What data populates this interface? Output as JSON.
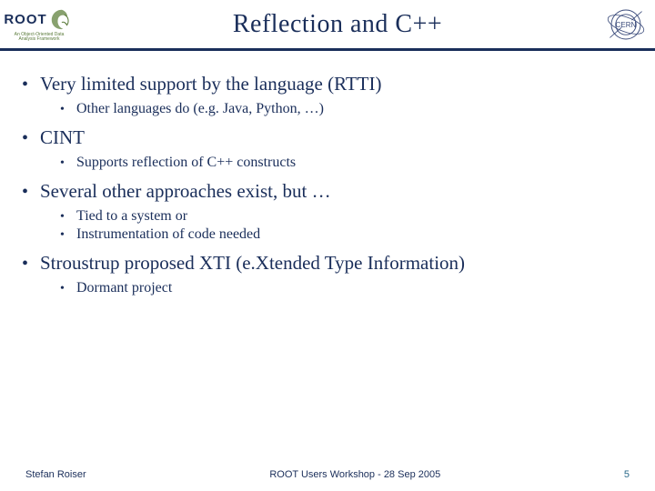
{
  "header": {
    "root_logo_text": "ROOT",
    "root_logo_sub": "An Object-Oriented Data Analysis Framework",
    "title": "Reflection and C++",
    "cern_label": "CERN"
  },
  "bullets": [
    {
      "text": "Very limited support by the language (RTTI)",
      "children": [
        "Other languages do (e.g. Java, Python, …)"
      ]
    },
    {
      "text": "CINT",
      "children": [
        "Supports reflection of C++ constructs"
      ]
    },
    {
      "text": "Several other approaches exist, but …",
      "children": [
        "Tied to a system or",
        "Instrumentation of code needed"
      ]
    },
    {
      "text": "Stroustrup proposed XTI (e.Xtended Type Information)",
      "children": [
        "Dormant project"
      ]
    }
  ],
  "footer": {
    "author": "Stefan Roiser",
    "event": "ROOT Users Workshop  -  28 Sep 2005",
    "page": "5"
  }
}
